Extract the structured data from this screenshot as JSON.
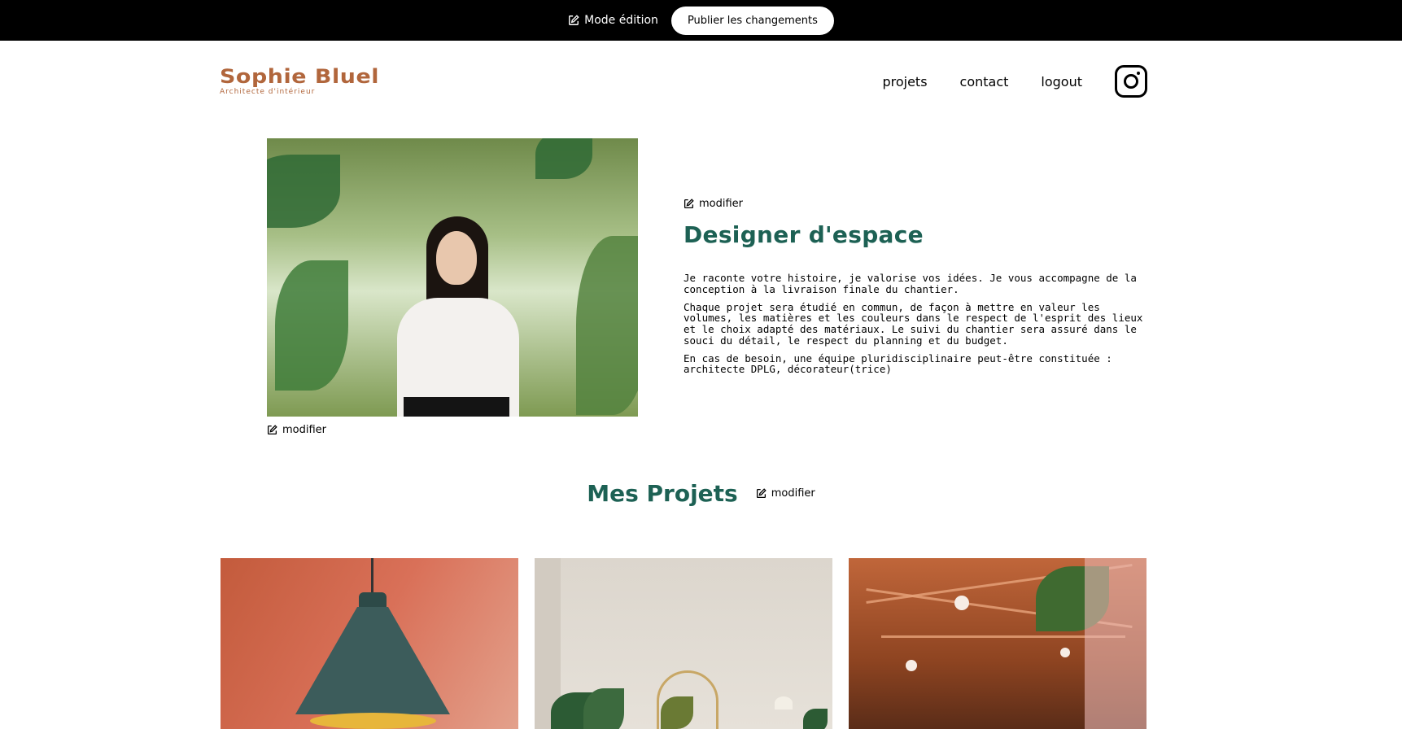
{
  "edit_bar": {
    "mode_label": "Mode édition",
    "publish_label": "Publier les changements"
  },
  "header": {
    "logo_name": "Sophie Bluel",
    "logo_subtitle": "Architecte d'intérieur",
    "nav": {
      "projets": "projets",
      "contact": "contact",
      "logout": "logout"
    }
  },
  "introduction": {
    "photo_modifier": "modifier",
    "text_modifier": "modifier",
    "title": "Designer d'espace",
    "paragraphs": [
      "Je raconte votre histoire, je valorise vos idées. Je vous accompagne de la conception à la livraison finale du chantier.",
      "Chaque projet sera étudié en commun, de façon à mettre en valeur les volumes, les matières et les couleurs dans le respect de l'esprit des lieux et le choix adapté des matériaux. Le suivi du chantier sera assuré dans le souci du détail, le respect du planning et du budget.",
      "En cas de besoin, une équipe pluridisciplinaire peut-être constituée : architecte DPLG, décorateur(trice)"
    ]
  },
  "portfolio": {
    "title": "Mes Projets",
    "modifier": "modifier"
  },
  "colors": {
    "brand": "#B1663C",
    "accent": "#1D6154",
    "edit_bar": "#000000"
  }
}
